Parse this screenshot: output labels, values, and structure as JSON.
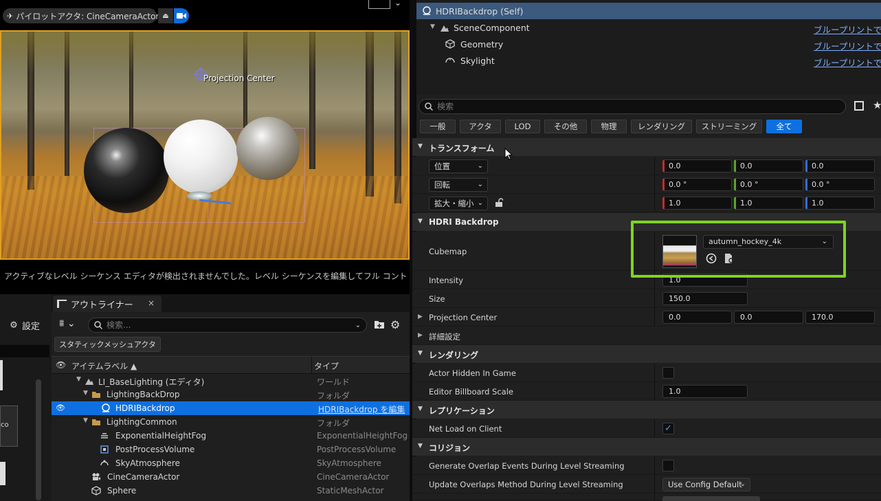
{
  "viewport": {
    "pilot_label": "パイロットアクタ: CineCameraActor",
    "projection_center_label": "Projection Center",
    "message": "アクティブなレベル シーケンス エディタが検出されませんでした。レベル シーケンスを編集してフル コント"
  },
  "left_panel": {
    "settings_label": "設定",
    "tile_label": "co"
  },
  "outliner": {
    "tab_label": "アウトライナー",
    "tab_close": "×",
    "search_placeholder": "検索...",
    "static_mesh_button": "スタティックメッシュアクタ",
    "col_label": "アイテムラベル ▲",
    "col_type": "タイプ",
    "rows": [
      {
        "name": "LI_BaseLighting (エディタ)",
        "type": "ワールド"
      },
      {
        "name": "LightingBackDrop",
        "type": "フォルダ"
      },
      {
        "name": "HDRIBackdrop",
        "type": "HDRIBackdrop を編集"
      },
      {
        "name": "LightingCommon",
        "type": "フォルダ"
      },
      {
        "name": "ExponentialHeightFog",
        "type": "ExponentialHeightFog"
      },
      {
        "name": "PostProcessVolume",
        "type": "PostProcessVolume"
      },
      {
        "name": "SkyAtmosphere",
        "type": "SkyAtmosphere"
      },
      {
        "name": "CineCameraActor",
        "type": "CineCameraActor"
      },
      {
        "name": "Sphere",
        "type": "StaticMeshActor"
      }
    ]
  },
  "components": {
    "rows": [
      {
        "label": "HDRIBackdrop (Self)",
        "link": ""
      },
      {
        "label": "SceneComponent",
        "link": "ブループリントで編"
      },
      {
        "label": "Geometry",
        "link": "ブループリントで編"
      },
      {
        "label": "Skylight",
        "link": "ブループリントで編"
      }
    ]
  },
  "details": {
    "search_placeholder": "検索",
    "filters": [
      "一般",
      "アクタ",
      "LOD",
      "その他",
      "物理",
      "レンダリング",
      "ストリーミング",
      "全て"
    ],
    "active_filter": "全て",
    "transform": {
      "title": "トランスフォーム",
      "location": {
        "label": "位置",
        "x": "0.0",
        "y": "0.0",
        "z": "0.0"
      },
      "rotation": {
        "label": "回転",
        "x": "0.0 °",
        "y": "0.0 °",
        "z": "0.0 °"
      },
      "scale": {
        "label": "拡大・縮小",
        "x": "1.0",
        "y": "1.0",
        "z": "1.0"
      }
    },
    "hdri": {
      "title": "HDRI Backdrop",
      "cubemap_label": "Cubemap",
      "cubemap_value": "autumn_hockey_4k",
      "intensity_label": "Intensity",
      "intensity_value": "1.0",
      "size_label": "Size",
      "size_value": "150.0",
      "proj_label": "Projection Center",
      "proj_x": "0.0",
      "proj_y": "0.0",
      "proj_z": "170.0",
      "advanced_label": "詳細設定"
    },
    "rendering": {
      "title": "レンダリング",
      "hidden_label": "Actor Hidden In Game",
      "billboard_label": "Editor Billboard Scale",
      "billboard_value": "1.0"
    },
    "replication": {
      "title": "レプリケーション",
      "net_load_label": "Net Load on Client"
    },
    "collision": {
      "title": "コリジョン",
      "overlap_label": "Generate Overlap Events During Level Streaming",
      "update_label": "Update Overlaps Method During Level Streaming",
      "update_value": "Use Config Default"
    }
  },
  "colors": {
    "accent": "#0e70e0",
    "highlight": "#7cd61e",
    "viewport_border": "#e0a020"
  }
}
